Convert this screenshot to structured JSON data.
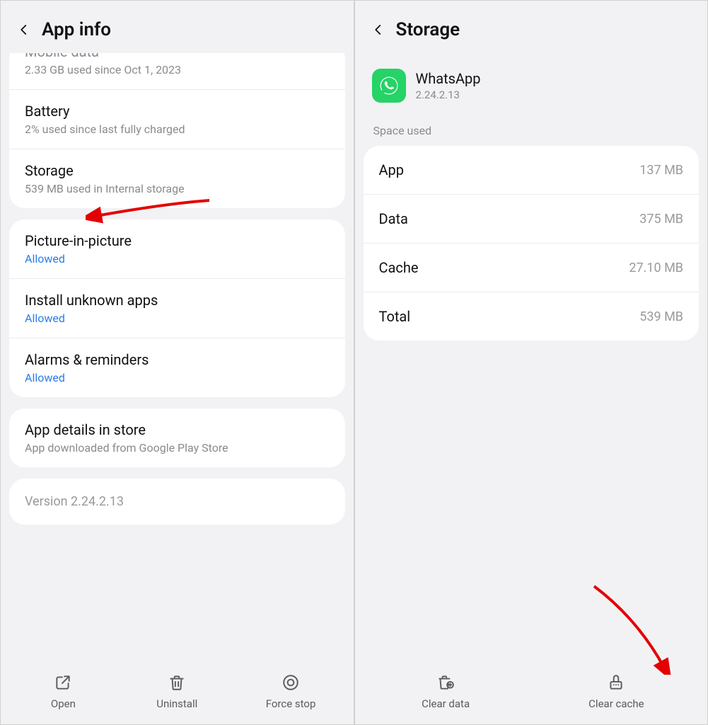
{
  "left": {
    "title": "App info",
    "rows": {
      "mobile_data": {
        "title": "Mobile data",
        "sub": "2.33 GB used since Oct 1, 2023"
      },
      "battery": {
        "title": "Battery",
        "sub": "2% used since last fully charged"
      },
      "storage": {
        "title": "Storage",
        "sub": "539 MB used in Internal storage"
      },
      "pip": {
        "title": "Picture-in-picture",
        "sub": "Allowed"
      },
      "unknown": {
        "title": "Install unknown apps",
        "sub": "Allowed"
      },
      "alarms": {
        "title": "Alarms & reminders",
        "sub": "Allowed"
      },
      "store": {
        "title": "App details in store",
        "sub": "App downloaded from Google Play Store"
      }
    },
    "version": "Version 2.24.2.13",
    "actions": {
      "open": "Open",
      "uninstall": "Uninstall",
      "forcestop": "Force stop"
    }
  },
  "right": {
    "title": "Storage",
    "app": {
      "name": "WhatsApp",
      "version": "2.24.2.13"
    },
    "section": "Space used",
    "rows": {
      "app": {
        "label": "App",
        "value": "137 MB"
      },
      "data": {
        "label": "Data",
        "value": "375 MB"
      },
      "cache": {
        "label": "Cache",
        "value": "27.10 MB"
      },
      "total": {
        "label": "Total",
        "value": "539 MB"
      }
    },
    "actions": {
      "clear_data": "Clear data",
      "clear_cache": "Clear cache"
    }
  }
}
